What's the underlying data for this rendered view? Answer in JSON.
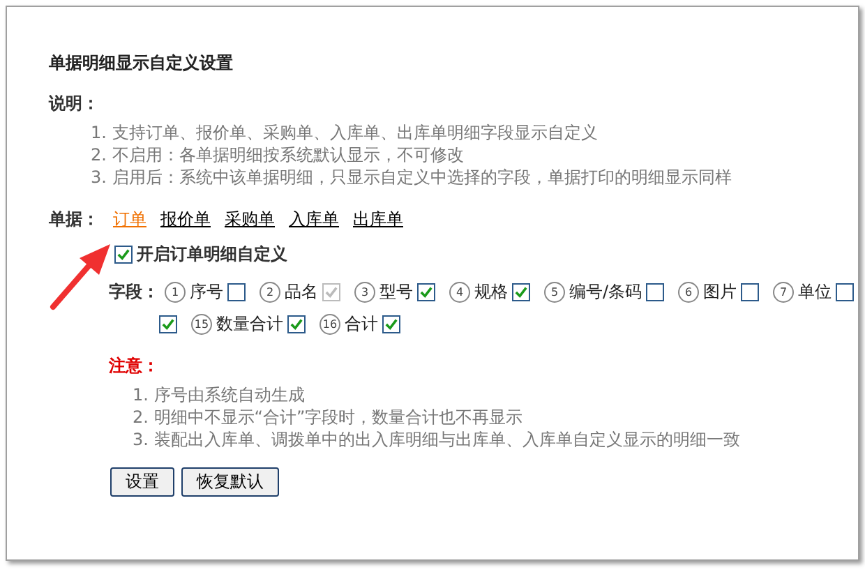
{
  "title": "单据明细显示自定义设置",
  "description": {
    "label": "说明：",
    "items": [
      "1. 支持订单、报价单、采购单、入库单、出库单明细字段显示自定义",
      "2. 不启用：各单据明细按系统默认显示，不可修改",
      "3. 启用后：系统中该单据明细，只显示自定义中选择的字段，单据打印的明细显示同样"
    ]
  },
  "doc_types": {
    "label": "单据：",
    "tabs": [
      {
        "label": "订单",
        "selected": true
      },
      {
        "label": "报价单",
        "selected": false
      },
      {
        "label": "采购单",
        "selected": false
      },
      {
        "label": "入库单",
        "selected": false
      },
      {
        "label": "出库单",
        "selected": false
      }
    ]
  },
  "enable": {
    "label": "开启订单明细自定义",
    "checked": true
  },
  "fields": {
    "label": "字段：",
    "rows": [
      [
        {
          "number": "1",
          "name": "序号",
          "checked": false,
          "disabled": false
        },
        {
          "number": "2",
          "name": "品名",
          "checked": true,
          "disabled": true
        },
        {
          "number": "3",
          "name": "型号",
          "checked": true,
          "disabled": false
        },
        {
          "number": "4",
          "name": "规格",
          "checked": true,
          "disabled": false
        },
        {
          "number": "5",
          "name": "编号/条码",
          "checked": false,
          "disabled": false
        },
        {
          "number": "6",
          "name": "图片",
          "checked": false,
          "disabled": false
        },
        {
          "number": "7",
          "name": "单位",
          "checked": false,
          "disabled": false
        }
      ],
      [
        {
          "checked": true,
          "disabled": false
        },
        {
          "number": "15",
          "name": "数量合计",
          "checked": true,
          "disabled": false
        },
        {
          "number": "16",
          "name": "合计",
          "checked": true,
          "disabled": false
        }
      ]
    ]
  },
  "notice": {
    "label": "注意：",
    "items": [
      "1. 序号由系统自动生成",
      "2. 明细中不显示“合计”字段时，数量合计也不再显示",
      "3. 装配出入库单、调拨单中的出入库明细与出库单、入库单自定义显示的明细一致"
    ]
  },
  "buttons": [
    "设置",
    "恢复默认"
  ]
}
